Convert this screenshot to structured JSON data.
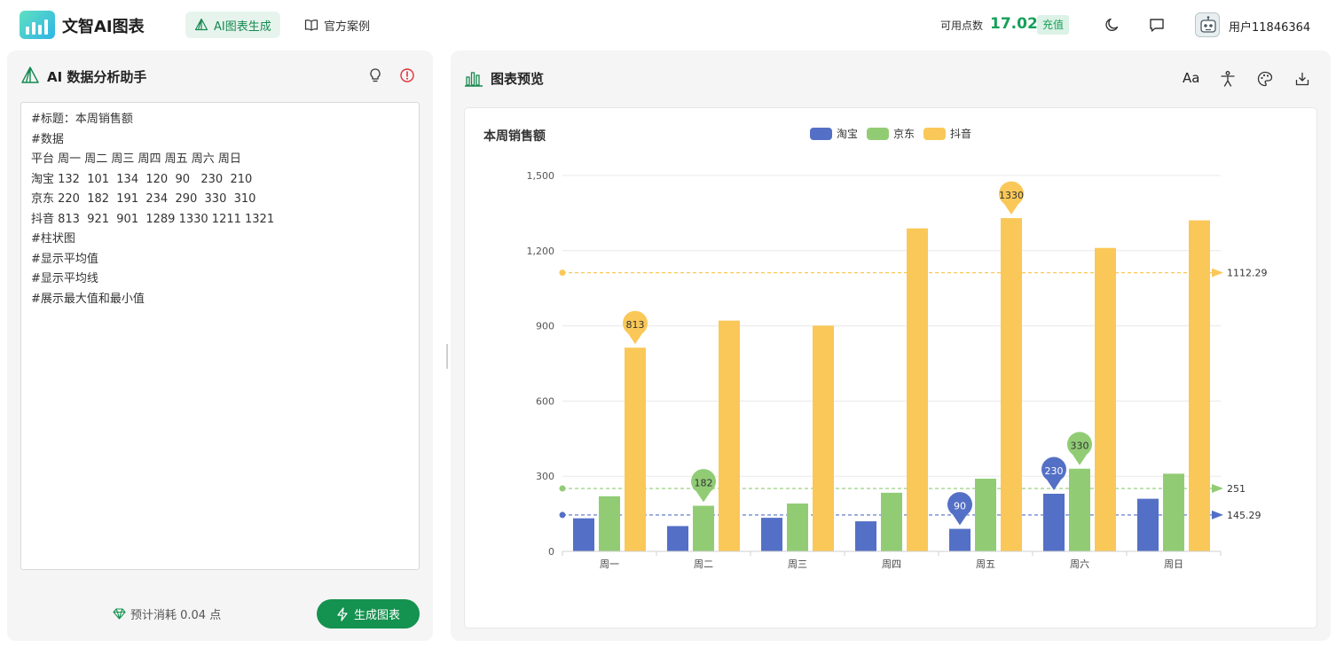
{
  "app": {
    "brand": "文智AI图表"
  },
  "nav": {
    "generate": "AI图表生成",
    "cases": "官方案例"
  },
  "account": {
    "credits_label": "可用点数",
    "credits_value": "17.02",
    "recharge": "充值",
    "username": "用户11846364"
  },
  "assistant": {
    "title": "AI 数据分析助手",
    "input_text": "#标题：本周销售额\n#数据\n平台 周一 周二 周三 周四 周五 周六 周日\n淘宝 132  101  134  120  90   230  210\n京东 220  182  191  234  290  330  310\n抖音 813  921  901  1289 1330 1211 1321\n#柱状图\n#显示平均值\n#显示平均线\n#展示最大值和最小值",
    "cost": "预计消耗 0.04 点",
    "generate_button": "生成图表"
  },
  "preview": {
    "title": "图表预览",
    "font_tool": "Aa"
  },
  "chart_data": {
    "type": "bar",
    "title": "本周销售额",
    "categories": [
      "周一",
      "周二",
      "周三",
      "周四",
      "周五",
      "周六",
      "周日"
    ],
    "series": [
      {
        "name": "淘宝",
        "color": "#5470c6",
        "values": [
          132,
          101,
          134,
          120,
          90,
          230,
          210
        ],
        "average": 145.29,
        "average_label": "145.29",
        "markers": [
          {
            "label": "90",
            "index": 4
          },
          {
            "label": "230",
            "index": 5
          }
        ]
      },
      {
        "name": "京东",
        "color": "#91cc75",
        "values": [
          220,
          182,
          191,
          234,
          290,
          330,
          310
        ],
        "average": 251,
        "average_label": "251",
        "markers": [
          {
            "label": "182",
            "index": 1
          },
          {
            "label": "330",
            "index": 5
          }
        ]
      },
      {
        "name": "抖音",
        "color": "#fac858",
        "values": [
          813,
          921,
          901,
          1289,
          1330,
          1211,
          1321
        ],
        "average": 1112.29,
        "average_label": "1112.29",
        "markers": [
          {
            "label": "813",
            "index": 0
          },
          {
            "label": "1330",
            "index": 4
          }
        ]
      }
    ],
    "yticks": [
      "0",
      "300",
      "600",
      "900",
      "1,200",
      "1,500"
    ],
    "ylim": [
      0,
      1500
    ],
    "grid": true,
    "legend_position": "top-center"
  }
}
